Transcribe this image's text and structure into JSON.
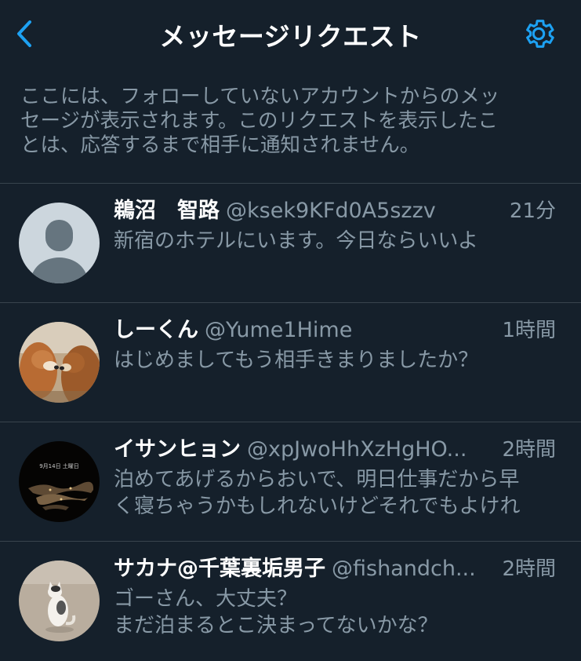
{
  "header": {
    "title": "メッセージリクエスト",
    "back_icon": "chevron-left-icon",
    "settings_icon": "gear-icon",
    "accent_color": "#1da1f2"
  },
  "description": {
    "line1": "ここには、フォローしていないアカウントからのメッ",
    "line2": "セージが表示されます。このリクエストを表示したこ",
    "line3": "とは、応答するまで相手に通知されません。"
  },
  "conversations": [
    {
      "name": "鵜沼　智路",
      "handle": "@ksek9KFd0A5szzv",
      "time": "21分",
      "message_lines": [
        "新宿のホテルにいます。今日ならいいよ"
      ],
      "avatar": "default-profile-avatar"
    },
    {
      "name": "しーくん",
      "handle": "@Yume1Hime",
      "time": "1時間",
      "message_lines": [
        "はじめましてもう相手きまりましたか？"
      ],
      "avatar": "dogs-photo-avatar"
    },
    {
      "name": "イサンヒョン",
      "handle": "@xpJwoHhXzHgHO...",
      "time": "2時間",
      "message_lines": [
        "泊めてあげるからおいで、明日仕事だから早",
        "く寝ちゃうかもしれないけどそれでもよけれ"
      ],
      "avatar": "night-view-photo-avatar",
      "avatar_caption": "9月14日 土曜日"
    },
    {
      "name": "サカナ@千葉裏垢男子",
      "handle": "@fishandch...",
      "time": "2時間",
      "message_lines": [
        "ゴーさん、大丈夫？",
        "まだ泊まるとこ決まってないかな？"
      ],
      "avatar": "cat-photo-avatar"
    }
  ]
}
